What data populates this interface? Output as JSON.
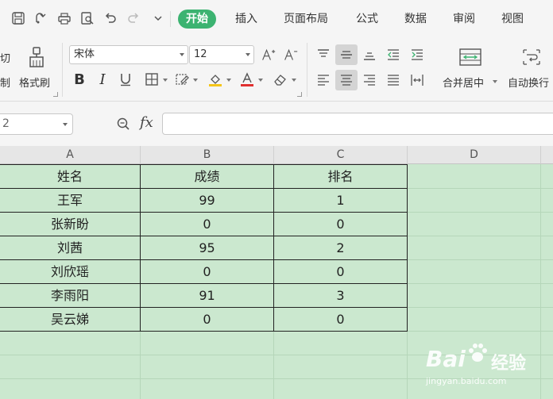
{
  "menu": {
    "tabs": [
      {
        "label": "开始",
        "active": true
      },
      {
        "label": "插入",
        "active": false
      },
      {
        "label": "页面布局",
        "active": false
      },
      {
        "label": "公式",
        "active": false
      },
      {
        "label": "数据",
        "active": false
      },
      {
        "label": "审阅",
        "active": false
      },
      {
        "label": "视图",
        "active": false
      }
    ]
  },
  "ribbon": {
    "cut_label_partial": "切",
    "copy_label_partial": "制",
    "format_painter_label": "格式刷",
    "font_name": "宋体",
    "font_size": "12",
    "merge_center_label": "合并居中",
    "auto_wrap_label": "自动换行"
  },
  "formula_bar": {
    "name_box_partial": "2",
    "fx_label": "fx",
    "formula": ""
  },
  "sheet": {
    "columns": [
      "A",
      "B",
      "C",
      "D"
    ],
    "headers": [
      "姓名",
      "成绩",
      "排名"
    ],
    "rows": [
      [
        "王军",
        "99",
        "1"
      ],
      [
        "张新盼",
        "0",
        "0"
      ],
      [
        "刘茜",
        "95",
        "2"
      ],
      [
        "刘欣瑶",
        "0",
        "0"
      ],
      [
        "李雨阳",
        "91",
        "3"
      ],
      [
        "吴云娣",
        "0",
        "0"
      ]
    ]
  },
  "watermark": {
    "logo_text": "Bai",
    "logo_suffix": "经验",
    "url": "jingyan.baidu.com"
  },
  "colors": {
    "accent": "#3cb371",
    "sheet_bg": "#cbe8cf",
    "font_color_bar": "#e03030",
    "highlight_bar": "#f5c518"
  }
}
